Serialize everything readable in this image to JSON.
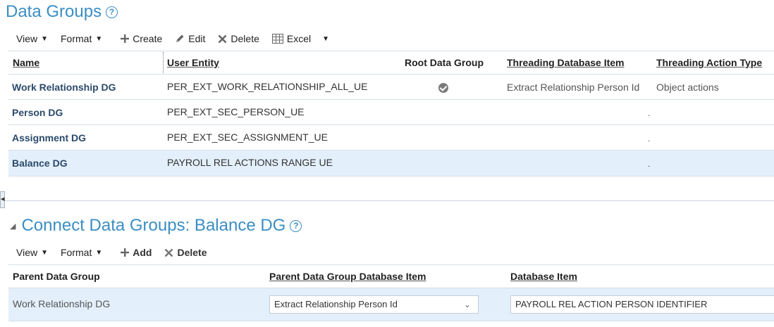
{
  "data_groups": {
    "title": "Data Groups",
    "toolbar": {
      "view": "View",
      "format": "Format",
      "create": "Create",
      "edit": "Edit",
      "delete": "Delete",
      "excel": "Excel"
    },
    "columns": {
      "name": "Name",
      "user_entity": "User Entity",
      "root": "Root Data Group",
      "threading_dbi": "Threading Database Item",
      "threading_action": "Threading Action Type"
    },
    "rows": [
      {
        "name": "Work Relationship DG",
        "user_entity": "PER_EXT_WORK_RELATIONSHIP_ALL_UE",
        "root": true,
        "threading_dbi": "Extract Relationship Person Id",
        "threading_action": "Object actions"
      },
      {
        "name": "Person DG",
        "user_entity": "PER_EXT_SEC_PERSON_UE",
        "root": false,
        "threading_dbi": "",
        "threading_action": "."
      },
      {
        "name": "Assignment DG",
        "user_entity": "PER_EXT_SEC_ASSIGNMENT_UE",
        "root": false,
        "threading_dbi": "",
        "threading_action": "."
      },
      {
        "name": "Balance DG",
        "user_entity": "PAYROLL REL ACTIONS RANGE UE",
        "root": false,
        "threading_dbi": "",
        "threading_action": ".",
        "selected": true
      }
    ]
  },
  "connect": {
    "title": "Connect Data Groups: Balance DG",
    "toolbar": {
      "view": "View",
      "format": "Format",
      "add": "Add",
      "delete": "Delete"
    },
    "columns": {
      "parent": "Parent Data Group",
      "parent_dbi": "Parent Data Group Database Item",
      "dbi": "Database Item"
    },
    "rows": [
      {
        "parent": "Work Relationship DG",
        "parent_dbi": "Extract Relationship Person Id",
        "dbi": "PAYROLL REL ACTION PERSON IDENTIFIER"
      }
    ]
  },
  "colors": {
    "title_blue": "#3b8ec4",
    "selected_row": "#e3effa",
    "grid_line": "#d6dfe6"
  },
  "icons": [
    "help-icon",
    "plus-icon",
    "pencil-icon",
    "x-icon",
    "excel-icon",
    "check-circle-icon",
    "chevron-down-icon",
    "collapse-triangle-icon"
  ]
}
